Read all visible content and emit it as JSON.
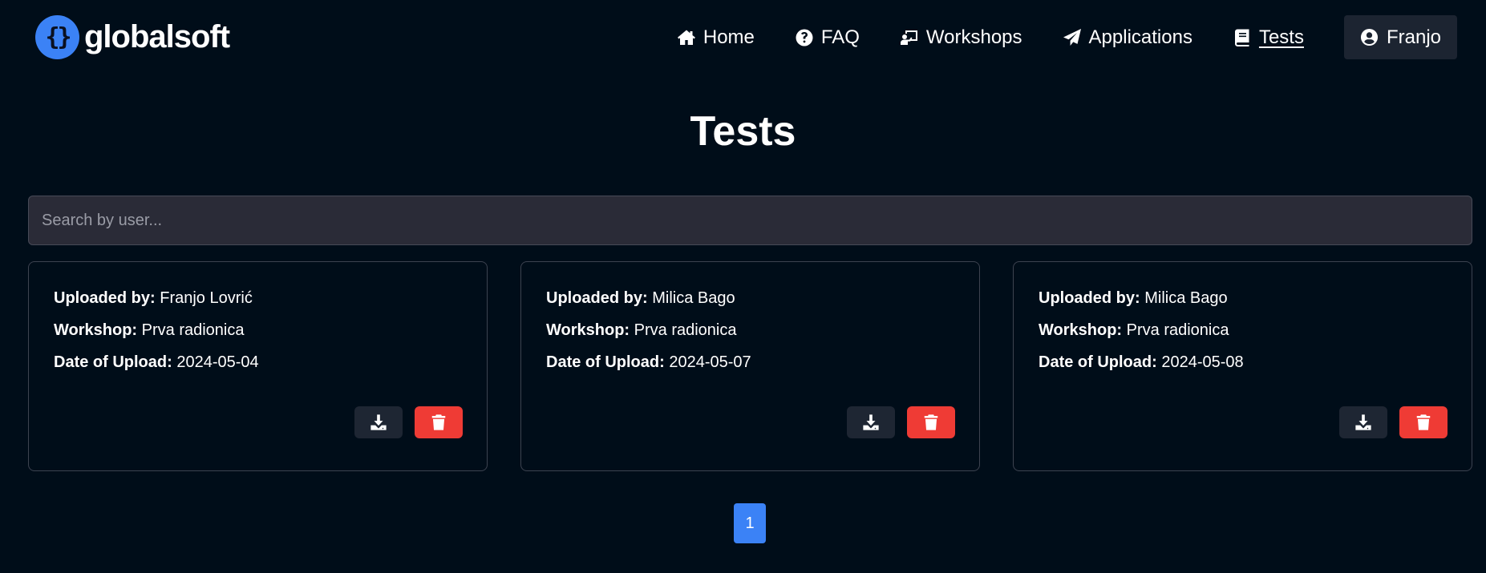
{
  "logo": {
    "icon_text": "{}",
    "text": "globalsoft",
    "icon": "braces-icon"
  },
  "nav": {
    "items": [
      {
        "label": "Home",
        "icon": "home-icon"
      },
      {
        "label": "FAQ",
        "icon": "question-circle-icon"
      },
      {
        "label": "Workshops",
        "icon": "chalkboard-teacher-icon"
      },
      {
        "label": "Applications",
        "icon": "paper-plane-icon"
      },
      {
        "label": "Tests",
        "icon": "book-icon",
        "active": true
      }
    ],
    "user": {
      "label": "Franjo",
      "icon": "user-circle-icon"
    }
  },
  "title": "Tests",
  "search": {
    "placeholder": "Search by user...",
    "value": ""
  },
  "labels": {
    "uploaded_by": "Uploaded by:",
    "workshop": "Workshop:",
    "date": "Date of Upload:"
  },
  "cards": [
    {
      "uploaded_by": "Franjo Lovrić",
      "workshop": "Prva radionica",
      "date": "2024-05-04"
    },
    {
      "uploaded_by": "Milica Bago",
      "workshop": "Prva radionica",
      "date": "2024-05-07"
    },
    {
      "uploaded_by": "Milica Bago",
      "workshop": "Prva radionica",
      "date": "2024-05-08"
    }
  ],
  "pagination": {
    "current": "1"
  },
  "colors": {
    "background": "#000d19",
    "accent": "#3b82f6",
    "danger": "#ef3b35",
    "button_dark": "#1e2633"
  }
}
